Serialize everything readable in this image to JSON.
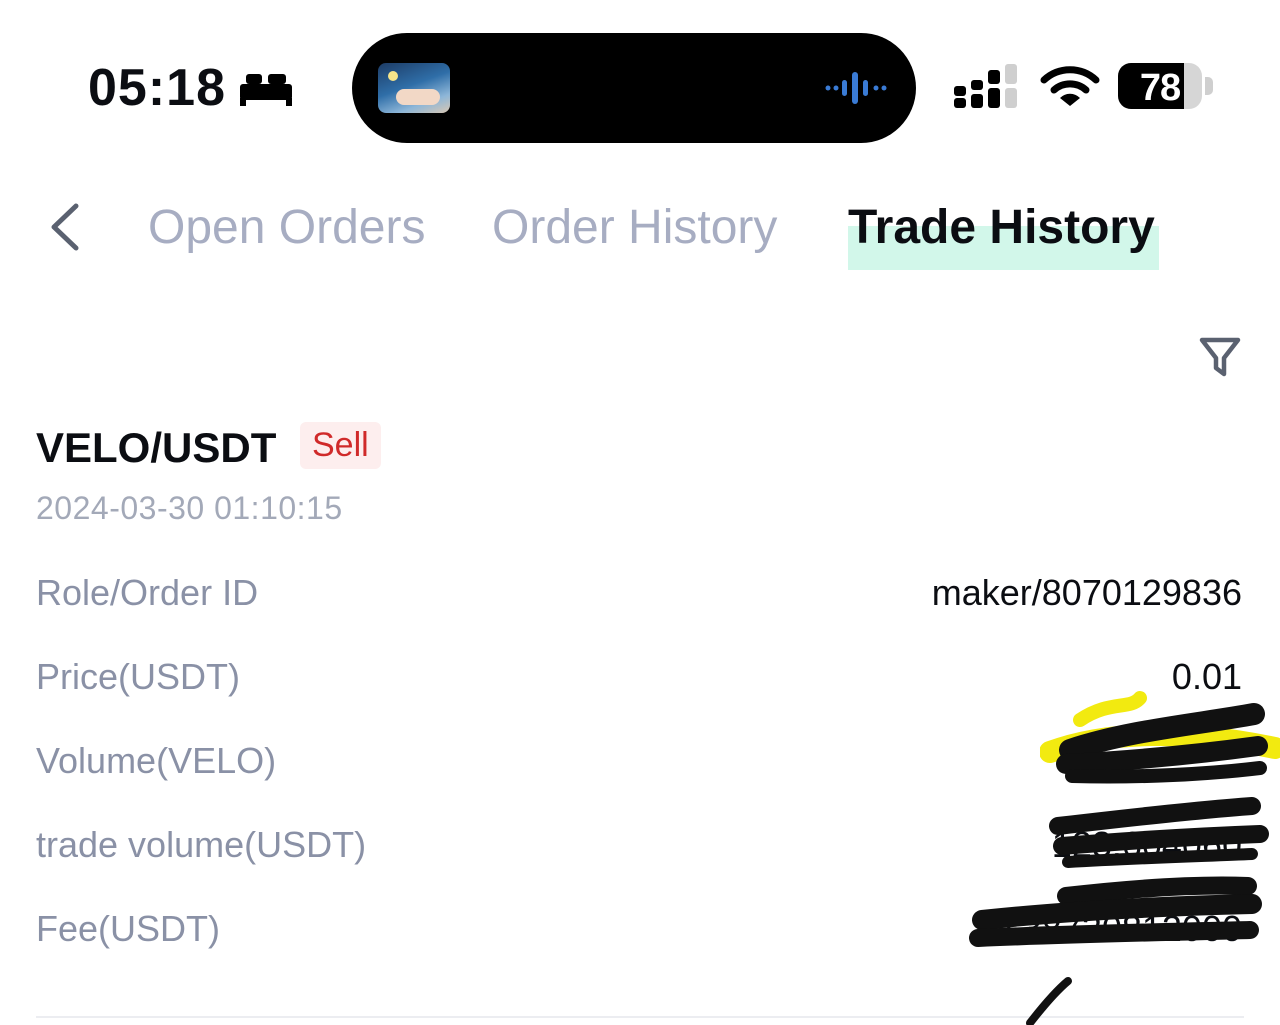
{
  "status_bar": {
    "time": "05:18",
    "focus_icon": "bed-icon",
    "battery_percent": "78",
    "battery_level": 0.78
  },
  "tabs": [
    {
      "label": "Open Orders",
      "active": false
    },
    {
      "label": "Order History",
      "active": false
    },
    {
      "label": "Trade History",
      "active": true
    }
  ],
  "record": {
    "pair": "VELO/USDT",
    "side": "Sell",
    "timestamp": "2024-03-30 01:10:15",
    "rows": [
      {
        "label": "Role/Order ID",
        "value": "maker/8070129836"
      },
      {
        "label": "Price(USDT)",
        "value": "0.01"
      },
      {
        "label": "Volume(VELO)",
        "value": ""
      },
      {
        "label": "trade volume(USDT)",
        "value": "123.604060"
      },
      {
        "label": "Fee(USDT)",
        "value": "0.38720812000"
      }
    ]
  },
  "colors": {
    "active_tab_highlight": "#d2f7ea",
    "inactive_tab": "#a7adc2",
    "sell_red": "#d02a2a",
    "label_gray": "#8a91a6"
  }
}
